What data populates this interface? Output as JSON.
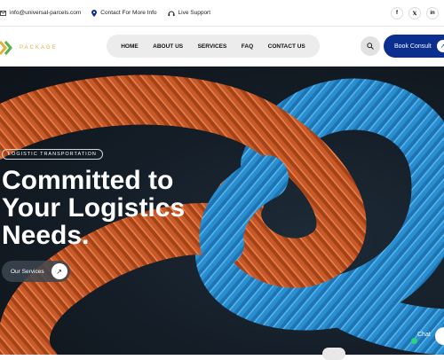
{
  "topbar": {
    "email": "info@universal-parcels.com",
    "more_info": "Contact For More Info",
    "live_support": "Live Support",
    "socials": [
      {
        "icon": "facebook-icon",
        "label": "f"
      },
      {
        "icon": "x-icon",
        "label": "𝕏"
      },
      {
        "icon": "linkedin-icon",
        "label": "in"
      }
    ]
  },
  "logo": {
    "text": "PACKAGE"
  },
  "nav": {
    "items": [
      "HOME",
      "ABOUT US",
      "SERVICES",
      "FAQ",
      "CONTACT US"
    ]
  },
  "actions": {
    "book_label": "Book Consult"
  },
  "hero": {
    "tag": "LOGISTIC TRANSPORTATION",
    "headline": "Committed to Your Logistics Needs.",
    "button_label": "Our Services"
  },
  "chat": {
    "label": "Chat"
  },
  "colors": {
    "brand": "#0b2f8e",
    "accent": "#e0b23a",
    "rope_orange": "#c85a2a",
    "rope_blue": "#2a8fd0"
  }
}
